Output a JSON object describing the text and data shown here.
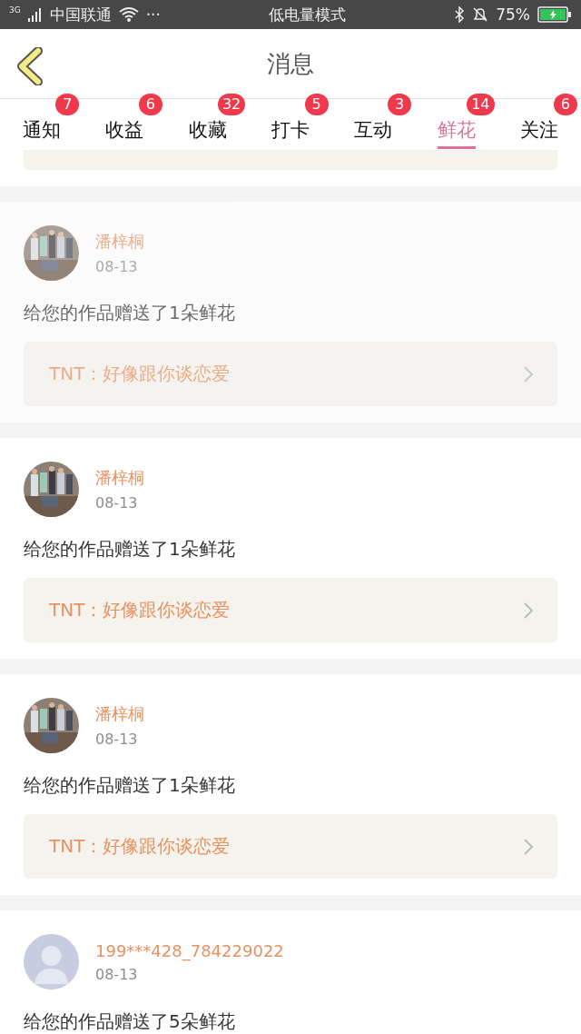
{
  "status_bar": {
    "network": "3G",
    "carrier": "中国联通",
    "dots": "···",
    "mode": "低电量模式",
    "battery": "75%"
  },
  "header": {
    "title": "消息"
  },
  "tabs": [
    {
      "label": "通知",
      "badge": "7",
      "selected": false
    },
    {
      "label": "收益",
      "badge": "6",
      "selected": false
    },
    {
      "label": "收藏",
      "badge": "32",
      "selected": false
    },
    {
      "label": "打卡",
      "badge": "5",
      "selected": false
    },
    {
      "label": "互动",
      "badge": "3",
      "selected": false
    },
    {
      "label": "鲜花",
      "badge": "14",
      "selected": true
    },
    {
      "label": "关注",
      "badge": "6",
      "selected": false
    }
  ],
  "messages": [
    {
      "name": "潘梓桐",
      "date": "08-13",
      "text": "给您的作品赠送了1朵鲜花",
      "quote": "TNT：好像跟你谈恋爱",
      "faded": true
    },
    {
      "name": "潘梓桐",
      "date": "08-13",
      "text": "给您的作品赠送了1朵鲜花",
      "quote": "TNT：好像跟你谈恋爱",
      "faded": false
    },
    {
      "name": "潘梓桐",
      "date": "08-13",
      "text": "给您的作品赠送了1朵鲜花",
      "quote": "TNT：好像跟你谈恋爱",
      "faded": false
    },
    {
      "kind": "default",
      "name": "199***428_784229022",
      "date": "08-13",
      "text": "给您的作品赠送了5朵鲜花",
      "faded": false
    }
  ]
}
